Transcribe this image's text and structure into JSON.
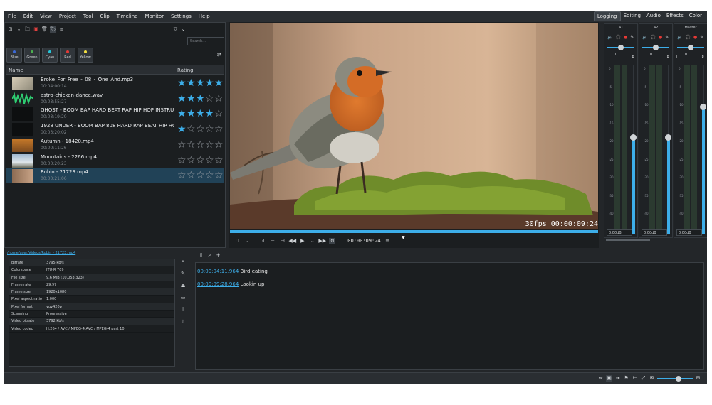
{
  "menu": [
    "File",
    "Edit",
    "View",
    "Project",
    "Tool",
    "Clip",
    "Timeline",
    "Monitor",
    "Settings",
    "Help"
  ],
  "layouts": [
    {
      "label": "Logging",
      "active": true
    },
    {
      "label": "Editing",
      "active": false
    },
    {
      "label": "Audio",
      "active": false
    },
    {
      "label": "Effects",
      "active": false
    },
    {
      "label": "Color",
      "active": false
    }
  ],
  "bin": {
    "search_placeholder": "Search...",
    "tags": [
      {
        "label": "Blue",
        "color": "#3b6ad9"
      },
      {
        "label": "Green",
        "color": "#4caf50"
      },
      {
        "label": "Cyan",
        "color": "#26c6da"
      },
      {
        "label": "Red",
        "color": "#e53935"
      },
      {
        "label": "Yellow",
        "color": "#f4e042"
      }
    ],
    "col_name": "Name",
    "col_rating": "Rating",
    "clips": [
      {
        "name": "Broke_For_Free_-_08_-_One_And.mp3",
        "duration": "00:04:00:14",
        "rating": 5,
        "selected": false,
        "thumb": "album"
      },
      {
        "name": "astro-chicken-dance.wav",
        "duration": "00:03:55:27",
        "rating": 3,
        "selected": false,
        "thumb": "wave"
      },
      {
        "name": "GHOST - BOOM BAP HARD BEAT RAP HIP HOP INSTRUMENT",
        "duration": "00:03:19:20",
        "rating": 4,
        "selected": false,
        "thumb": "dark"
      },
      {
        "name": "1928 UNDER - BOOM BAP 808 HARD RAP BEAT HIP HOP INS",
        "duration": "00:03:20:02",
        "rating": 1,
        "selected": false,
        "thumb": "dark"
      },
      {
        "name": "Autumn - 18420.mp4",
        "duration": "00:00:11:26",
        "rating": 0,
        "selected": false,
        "thumb": "autumn"
      },
      {
        "name": "Mountains - 2266.mp4",
        "duration": "00:00:20:23",
        "rating": 0,
        "selected": false,
        "thumb": "mountain"
      },
      {
        "name": "Robin - 21723.mp4",
        "duration": "00:00:21:06",
        "rating": 0,
        "selected": true,
        "thumb": "robin"
      }
    ]
  },
  "monitor": {
    "overlay_tc": "30fps 00:00:09:24",
    "zoom": "1:1",
    "timecode": "00:00:09:24"
  },
  "mixer": {
    "tracks": [
      {
        "name": "A1",
        "volume": "0.00dB",
        "level": 0.58
      },
      {
        "name": "A2",
        "volume": "0.00dB",
        "level": 0.58
      },
      {
        "name": "Master",
        "volume": "0.00dB",
        "level": 0.76
      }
    ],
    "db_labels": [
      "0",
      "-5",
      "-10",
      "-15",
      "-20",
      "-25",
      "-30",
      "-35",
      "-40",
      "-45"
    ]
  },
  "clip_path": "/home/user/Videos/Robin - 21723.mp4",
  "properties": [
    {
      "key": "Bitrate",
      "value": "3795 kb/s"
    },
    {
      "key": "Colorspace",
      "value": "ITU-R 709"
    },
    {
      "key": "File size",
      "value": "9.6 MiB (10,053,323)"
    },
    {
      "key": "Frame rate",
      "value": "29.97"
    },
    {
      "key": "Frame size",
      "value": "1920x1080"
    },
    {
      "key": "Pixel aspect ratio",
      "value": "1.000"
    },
    {
      "key": "Pixel format",
      "value": "yuv420p"
    },
    {
      "key": "Scanning",
      "value": "Progressive"
    },
    {
      "key": "Video bitrate",
      "value": "3792 kb/s"
    },
    {
      "key": "Video codec",
      "value": "H.264 / AVC / MPEG-4 AVC / MPEG-4 part 10"
    }
  ],
  "markers": [
    {
      "time": "00:00:04:11.964",
      "label": "Bird eating"
    },
    {
      "time": "00:00:09:28.964",
      "label": "Lookin up"
    }
  ]
}
